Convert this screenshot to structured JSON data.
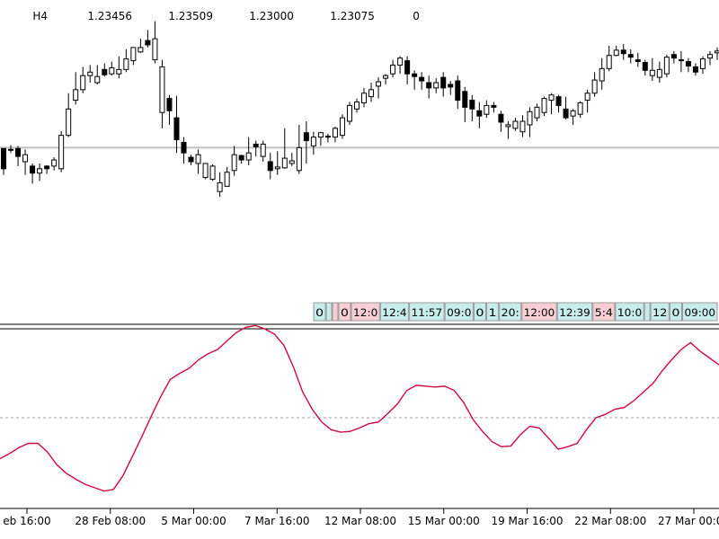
{
  "chart_data": [
    {
      "type": "candlestick",
      "timeframe": "H4",
      "header": {
        "timeframe": "H4",
        "open": "1.23456",
        "high": "1.23509",
        "low": "1.23000",
        "close": "1.23075",
        "volume": "0"
      },
      "ylim": [
        0,
        360
      ],
      "level_line": 196,
      "candles": [
        [
          195,
          172,
          195,
          165
        ],
        [
          194,
          193,
          199,
          190
        ],
        [
          195,
          186,
          198,
          175
        ],
        [
          180,
          188,
          194,
          165
        ],
        [
          175,
          167,
          178,
          155
        ],
        [
          167,
          172,
          178,
          158
        ],
        [
          175,
          172,
          176,
          166
        ],
        [
          175,
          182,
          185,
          170
        ],
        [
          172,
          210,
          215,
          168
        ],
        [
          210,
          240,
          258,
          208
        ],
        [
          250,
          262,
          282,
          245
        ],
        [
          262,
          278,
          288,
          258
        ],
        [
          278,
          282,
          290,
          270
        ],
        [
          270,
          277,
          290,
          268
        ],
        [
          285,
          279,
          292,
          277
        ],
        [
          280,
          287,
          294,
          278
        ],
        [
          280,
          285,
          300,
          275
        ],
        [
          285,
          297,
          308,
          282
        ],
        [
          295,
          310,
          310,
          290
        ],
        [
          305,
          310,
          320,
          304
        ],
        [
          318,
          313,
          330,
          310
        ],
        [
          296,
          320,
          340,
          292
        ],
        [
          236,
          288,
          296,
          218
        ],
        [
          252,
          238,
          256,
          222
        ],
        [
          230,
          205,
          255,
          190
        ],
        [
          202,
          190,
          208,
          178
        ],
        [
          185,
          180,
          188,
          176
        ],
        [
          178,
          188,
          194,
          166
        ],
        [
          162,
          178,
          174,
          160
        ],
        [
          160,
          175,
          177,
          158
        ],
        [
          146,
          156,
          168,
          140
        ],
        [
          152,
          168,
          174,
          152
        ],
        [
          170,
          188,
          198,
          164
        ],
        [
          187,
          182,
          188,
          178
        ],
        [
          182,
          190,
          208,
          176
        ],
        [
          200,
          197,
          204,
          186
        ],
        [
          186,
          200,
          204,
          180
        ],
        [
          180,
          170,
          190,
          160
        ],
        [
          172,
          174,
          192,
          165
        ],
        [
          173,
          184,
          218,
          172
        ],
        [
          178,
          181,
          190,
          175
        ],
        [
          170,
          196,
          222,
          166
        ],
        [
          213,
          204,
          226,
          178
        ],
        [
          198,
          208,
          214,
          188
        ],
        [
          208,
          213,
          214,
          198
        ],
        [
          209,
          208,
          212,
          202
        ],
        [
          208,
          218,
          220,
          202
        ],
        [
          210,
          230,
          234,
          206
        ],
        [
          226,
          244,
          248,
          222
        ],
        [
          240,
          248,
          252,
          236
        ],
        [
          247,
          258,
          264,
          242
        ],
        [
          254,
          262,
          270,
          248
        ],
        [
          266,
          271,
          276,
          252
        ],
        [
          275,
          278,
          280,
          268
        ],
        [
          280,
          290,
          296,
          276
        ],
        [
          290,
          298,
          300,
          280
        ],
        [
          295,
          280,
          300,
          268
        ],
        [
          280,
          277,
          284,
          262
        ],
        [
          276,
          272,
          282,
          262
        ],
        [
          270,
          264,
          278,
          252
        ],
        [
          264,
          270,
          275,
          258
        ],
        [
          276,
          264,
          282,
          254
        ],
        [
          268,
          265,
          272,
          256
        ],
        [
          272,
          250,
          278,
          240
        ],
        [
          260,
          242,
          265,
          225
        ],
        [
          250,
          240,
          256,
          226
        ],
        [
          238,
          232,
          248,
          218
        ],
        [
          234,
          244,
          250,
          230
        ],
        [
          244,
          242,
          248,
          236
        ],
        [
          234,
          225,
          238,
          214
        ],
        [
          220,
          222,
          226,
          206
        ],
        [
          218,
          226,
          230,
          215
        ],
        [
          214,
          226,
          233,
          208
        ],
        [
          222,
          237,
          242,
          208
        ],
        [
          230,
          242,
          246,
          226
        ],
        [
          236,
          252,
          254,
          232
        ],
        [
          250,
          256,
          258,
          234
        ],
        [
          254,
          244,
          256,
          236
        ],
        [
          240,
          230,
          254,
          228
        ],
        [
          232,
          238,
          240,
          222
        ],
        [
          234,
          247,
          249,
          230
        ],
        [
          250,
          258,
          262,
          236
        ],
        [
          258,
          273,
          282,
          254
        ],
        [
          272,
          286,
          298,
          262
        ],
        [
          286,
          301,
          312,
          283
        ],
        [
          301,
          307,
          312,
          300
        ],
        [
          307,
          303,
          314,
          296
        ],
        [
          302,
          299,
          308,
          292
        ],
        [
          296,
          294,
          304,
          288
        ],
        [
          293,
          284,
          296,
          278
        ],
        [
          278,
          284,
          298,
          272
        ],
        [
          276,
          285,
          294,
          270
        ],
        [
          280,
          299,
          302,
          276
        ],
        [
          302,
          298,
          306,
          292
        ],
        [
          296,
          296,
          306,
          282
        ],
        [
          294,
          289,
          298,
          282
        ],
        [
          288,
          282,
          292,
          278
        ],
        [
          286,
          297,
          300,
          280
        ],
        [
          298,
          302,
          306,
          290
        ],
        [
          304,
          306,
          310,
          296
        ]
      ]
    },
    {
      "type": "line",
      "ylim": [
        0,
        200
      ],
      "level_line": 100,
      "series": [
        {
          "color": "#d10a3f",
          "values": [
            52,
            58,
            65,
            70,
            70,
            60,
            45,
            35,
            28,
            22,
            18,
            14,
            16,
            32,
            55,
            78,
            102,
            125,
            145,
            152,
            158,
            168,
            175,
            180,
            190,
            200,
            206,
            208,
            204,
            198,
            185,
            160,
            130,
            110,
            95,
            86,
            83,
            84,
            88,
            93,
            95,
            105,
            116,
            132,
            138,
            137,
            136,
            137,
            132,
            118,
            98,
            84,
            72,
            66,
            67,
            80,
            90,
            88,
            76,
            63,
            66,
            70,
            86,
            100,
            104,
            110,
            112,
            120,
            130,
            140,
            155,
            168,
            180,
            188,
            178,
            170,
            162
          ]
        }
      ]
    }
  ],
  "time_axis": {
    "labels": [
      "eb 16:00",
      "28 Feb 08:00",
      "5 Mar 00:00",
      "7 Mar 16:00",
      "12 Mar 08:00",
      "15 Mar 00:00",
      "19 Mar 16:00",
      "22 Mar 08:00",
      "27 Mar 00:00"
    ]
  },
  "trade_tags": [
    {
      "text": "0",
      "bg": "#c8ecec"
    },
    {
      "text": "",
      "bg": "#c8ecec"
    },
    {
      "text": "",
      "bg": "#f7cfd4"
    },
    {
      "text": "0",
      "bg": "#f7cfd4"
    },
    {
      "text": "12:0",
      "bg": "#f7cfd4"
    },
    {
      "text": "12:4",
      "bg": "#c8ecec"
    },
    {
      "text": "11:57",
      "bg": "#c8ecec"
    },
    {
      "text": "09:0",
      "bg": "#c8ecec"
    },
    {
      "text": "0",
      "bg": "#c8ecec"
    },
    {
      "text": "1",
      "bg": "#c8ecec"
    },
    {
      "text": "20:",
      "bg": "#c8ecec"
    },
    {
      "text": "12:00",
      "bg": "#f7cfd4"
    },
    {
      "text": "12:39",
      "bg": "#c8ecec"
    },
    {
      "text": "5:4",
      "bg": "#f7cfd4"
    },
    {
      "text": "10:0",
      "bg": "#c8ecec"
    },
    {
      "text": "",
      "bg": "#c8ecec"
    },
    {
      "text": "12",
      "bg": "#c8ecec"
    },
    {
      "text": "0",
      "bg": "#c8ecec"
    },
    {
      "text": "09:00",
      "bg": "#c8ecec"
    }
  ],
  "colors": {
    "background": "#ffffff",
    "candle_up_fill": "#ffffff",
    "candle_down_fill": "#000000",
    "wick": "#000000",
    "level_line": "#c0c0c0",
    "indicator": "#d10a3f",
    "indicator_level": "#a0a0a0",
    "tag_buy": "#c8ecec",
    "tag_sell": "#f7cfd4"
  }
}
